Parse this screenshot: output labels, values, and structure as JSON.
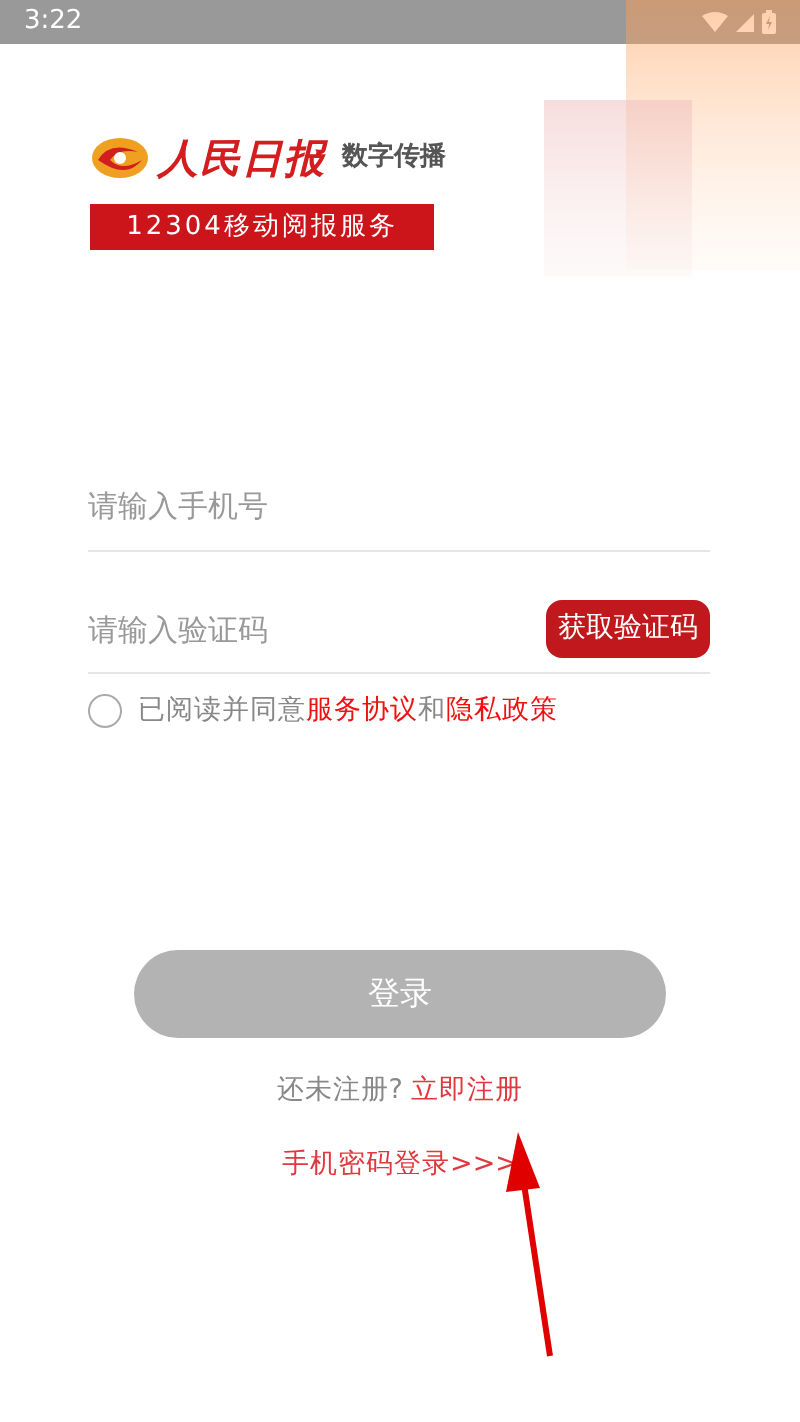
{
  "status_bar": {
    "time": "3:22"
  },
  "logo": {
    "brand": "人民日报",
    "tagline": "数字传播",
    "banner": "12304移动阅报服务"
  },
  "phone_field": {
    "placeholder": "请输入手机号"
  },
  "code_field": {
    "placeholder": "请输入验证码",
    "button": "获取验证码"
  },
  "agreement": {
    "checked": false,
    "text": "已阅读并同意",
    "link_1": "服务协议",
    "joiner": "和",
    "link_2": "隐私政策"
  },
  "login_button": {
    "label": "登录",
    "disabled": true
  },
  "register": {
    "prompt": "还未注册?",
    "link": "立即注册"
  },
  "password_login": {
    "label": "手机密码登录>>>"
  }
}
